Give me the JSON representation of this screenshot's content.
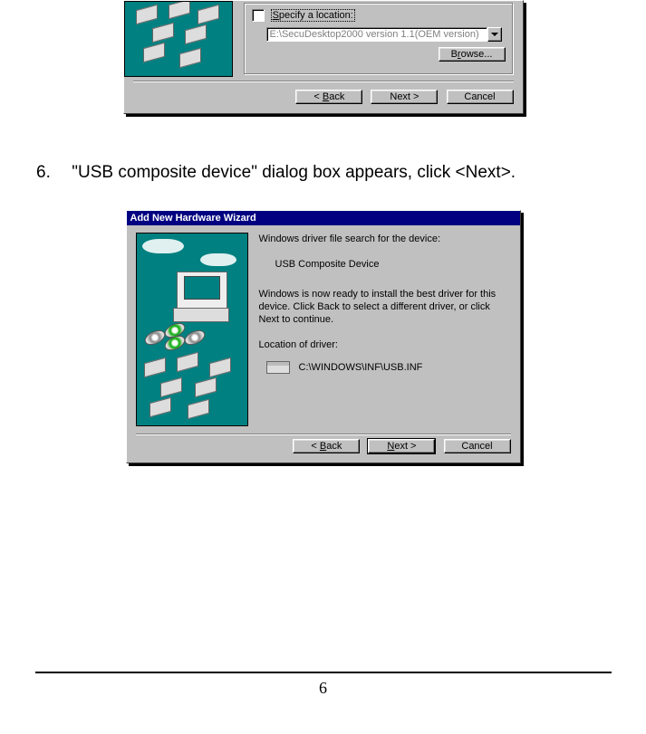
{
  "dialog1": {
    "specify_label_pre": "S",
    "specify_label_rest": "pecify a location:",
    "location_value": "E:\\SecuDesktop2000 version 1.1(OEM version)",
    "browse_pre": "B",
    "browse_mid": "r",
    "browse_rest": "owse...",
    "back_pre": "< ",
    "back_u": "B",
    "back_rest": "ack",
    "next": "Next >",
    "cancel": "Cancel"
  },
  "step6": {
    "num": "6.",
    "text_prefix": "\"",
    "text_main": "USB composite device",
    "text_mid": "\" dialog box appears, click <Next>."
  },
  "dialog2": {
    "title": "Add New Hardware Wizard",
    "line1": "Windows driver file search for the device:",
    "device": "USB Composite Device",
    "line2": "Windows is now ready to install the best driver for this device. Click Back to select a different driver, or click Next to continue.",
    "loc_label": "Location of driver:",
    "loc_value": "C:\\WINDOWS\\INF\\USB.INF",
    "back_pre": "< ",
    "back_u": "B",
    "back_rest": "ack",
    "next_u": "N",
    "next_rest": "ext >",
    "cancel": "Cancel"
  },
  "page_number": "6"
}
